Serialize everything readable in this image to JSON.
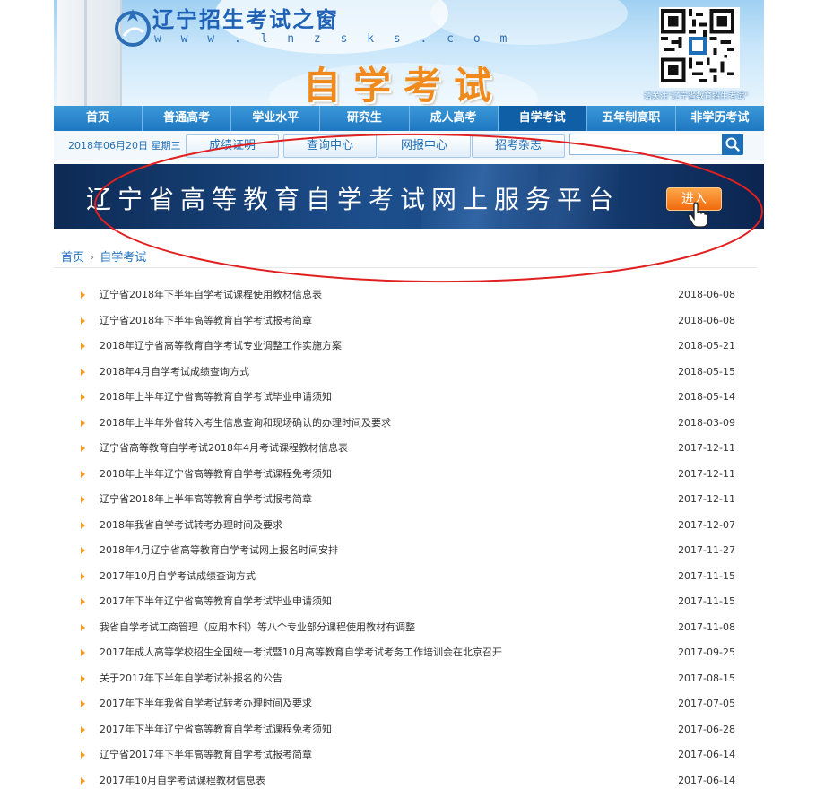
{
  "header": {
    "site_name": "辽宁招生考试之窗",
    "site_url": "w w w . l n z s k s . c o m",
    "page_heading": "自学考试",
    "qr_caption": "请关注\"辽宁省教育招生考试\""
  },
  "nav": {
    "items": [
      "首页",
      "普通高考",
      "学业水平",
      "研究生",
      "成人高考",
      "自学考试",
      "五年制高职",
      "非学历考试"
    ],
    "active": "自学考试"
  },
  "subbar": {
    "date": "2018年06月20日 星期三",
    "buttons": [
      "成绩证明",
      "查询中心",
      "网报中心",
      "招考杂志"
    ],
    "search_value": ""
  },
  "promo": {
    "title": "辽宁省高等教育自学考试网上服务平台",
    "enter_label": "进入"
  },
  "breadcrumb": {
    "home": "首页",
    "separator": "›",
    "current": "自学考试"
  },
  "news": [
    {
      "title": "辽宁省2018年下半年自学考试课程使用教材信息表",
      "date": "2018-06-08"
    },
    {
      "title": "辽宁省2018年下半年高等教育自学考试报考简章",
      "date": "2018-06-08"
    },
    {
      "title": "2018年辽宁省高等教育自学考试专业调整工作实施方案",
      "date": "2018-05-21"
    },
    {
      "title": "2018年4月自学考试成绩查询方式",
      "date": "2018-05-15"
    },
    {
      "title": "2018年上半年辽宁省高等教育自学考试毕业申请须知",
      "date": "2018-05-14"
    },
    {
      "title": "2018年上半年外省转入考生信息查询和现场确认的办理时间及要求",
      "date": "2018-03-09"
    },
    {
      "title": "辽宁省高等教育自学考试2018年4月考试课程教材信息表",
      "date": "2017-12-11"
    },
    {
      "title": "2018年上半年辽宁省高等教育自学考试课程免考须知",
      "date": "2017-12-11"
    },
    {
      "title": "辽宁省2018年上半年高等教育自学考试报考简章",
      "date": "2017-12-11"
    },
    {
      "title": "2018年我省自学考试转考办理时间及要求",
      "date": "2017-12-07"
    },
    {
      "title": "2018年4月辽宁省高等教育自学考试网上报名时间安排",
      "date": "2017-11-27"
    },
    {
      "title": "2017年10月自学考试成绩查询方式",
      "date": "2017-11-15"
    },
    {
      "title": "2017年下半年辽宁省高等教育自学考试毕业申请须知",
      "date": "2017-11-15"
    },
    {
      "title": "我省自学考试工商管理（应用本科）等八个专业部分课程使用教材有调整",
      "date": "2017-11-08"
    },
    {
      "title": "2017年成人高等学校招生全国统一考试暨10月高等教育自学考试考务工作培训会在北京召开",
      "date": "2017-09-25"
    },
    {
      "title": "关于2017年下半年自学考试补报名的公告",
      "date": "2017-08-15"
    },
    {
      "title": "2017年下半年我省自学考试转考办理时间及要求",
      "date": "2017-07-05"
    },
    {
      "title": "2017年下半年辽宁省高等教育自学考试课程免考须知",
      "date": "2017-06-28"
    },
    {
      "title": "辽宁省2017年下半年高等教育自学考试报考简章",
      "date": "2017-06-14"
    },
    {
      "title": "2017年10月自学考试课程教材信息表",
      "date": "2017-06-14"
    }
  ],
  "colors": {
    "nav_bg": "#1f78c2",
    "nav_active": "#0e5fa6",
    "heading_orange": "#f08a1c",
    "link_blue": "#1f6fb8",
    "bullet_orange": "#f39a1d",
    "annotation_red": "#e02020"
  }
}
